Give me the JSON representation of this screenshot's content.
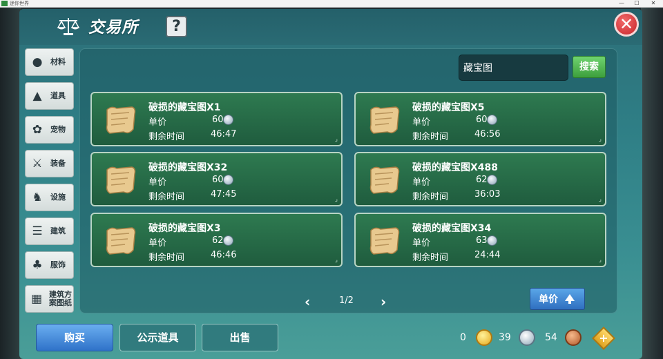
{
  "window": {
    "title": "迷你世界",
    "min": "—",
    "max": "☐",
    "close": "✕"
  },
  "header": {
    "title": "交易所",
    "help": "?",
    "close": "✕"
  },
  "sidebar": {
    "items": [
      {
        "label": "材料",
        "icon": "materials-icon",
        "glyph": "●"
      },
      {
        "label": "道具",
        "icon": "item-icon",
        "glyph": "▲"
      },
      {
        "label": "宠物",
        "icon": "paw-icon",
        "glyph": "✿"
      },
      {
        "label": "装备",
        "icon": "sword-icon",
        "glyph": "⚔"
      },
      {
        "label": "设施",
        "icon": "horse-icon",
        "glyph": "♞"
      },
      {
        "label": "建筑",
        "icon": "building-icon",
        "glyph": "☰"
      },
      {
        "label": "服饰",
        "icon": "clothes-icon",
        "glyph": "♣"
      },
      {
        "label": "建筑方案图纸",
        "icon": "blueprint-icon",
        "glyph": "▦"
      }
    ]
  },
  "search": {
    "value": "藏宝图",
    "button": "搜索"
  },
  "listing": {
    "price_label": "单价",
    "time_label": "剩余时间",
    "items": [
      {
        "name": "破损的藏宝图X1",
        "price": "60",
        "time": "46:47"
      },
      {
        "name": "破损的藏宝图X5",
        "price": "60",
        "time": "46:56"
      },
      {
        "name": "破损的藏宝图X32",
        "price": "60",
        "time": "47:45"
      },
      {
        "name": "破损的藏宝图X488",
        "price": "62",
        "time": "36:03"
      },
      {
        "name": "破损的藏宝图X3",
        "price": "62",
        "time": "46:46"
      },
      {
        "name": "破损的藏宝图X34",
        "price": "63",
        "time": "24:44"
      }
    ]
  },
  "pager": {
    "prev": "‹",
    "text": "1/2",
    "next": "›"
  },
  "sort": {
    "label": "单价"
  },
  "footer": {
    "buy": "购买",
    "publicize": "公示道具",
    "sell": "出售"
  },
  "currency": {
    "gold": "0",
    "silver": "39",
    "bronze": "54",
    "add": "+"
  }
}
